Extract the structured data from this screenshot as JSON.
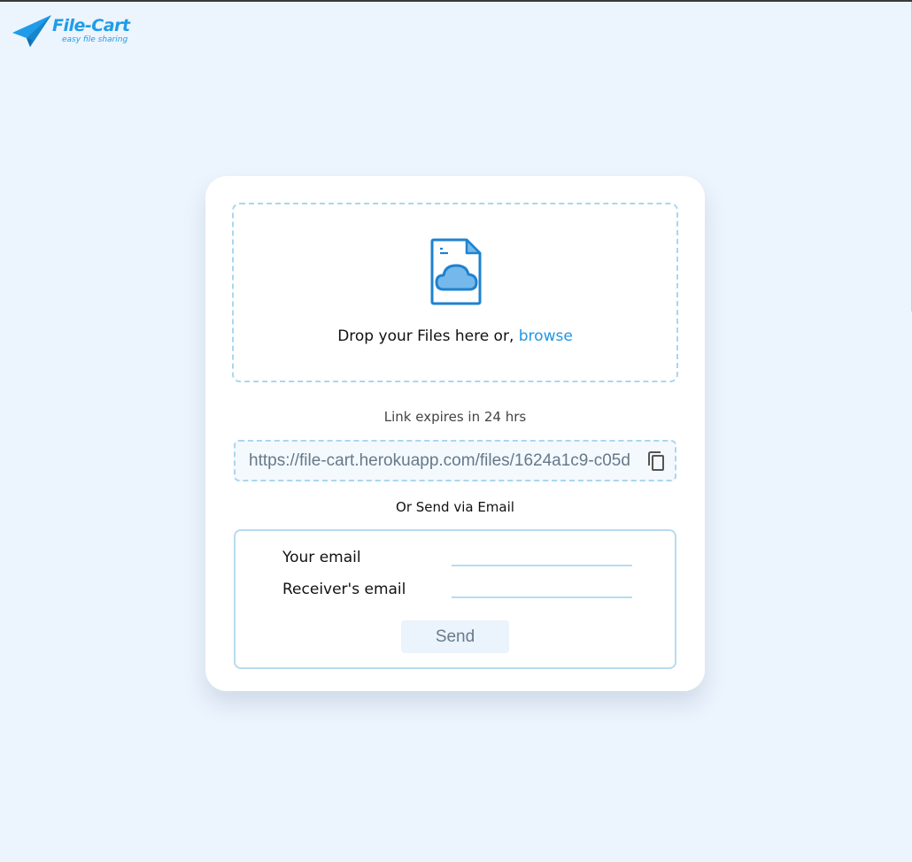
{
  "brand": {
    "name": "File-Cart",
    "tagline": "easy file sharing",
    "logo_icon": "paper-plane-icon",
    "color": "#1f9ce9"
  },
  "dropzone": {
    "icon": "file-cloud-icon",
    "prompt": "Drop your Files here or, ",
    "browse_label": "browse"
  },
  "share": {
    "expiry_text": "Link expires in 24 hrs",
    "link_value": "https://file-cart.herokuapp.com/files/1624a1c9-c05d",
    "copy_icon": "copy-icon"
  },
  "email": {
    "heading": "Or Send via Email",
    "sender_label": "Your email",
    "sender_value": "",
    "receiver_label": "Receiver's email",
    "receiver_value": "",
    "send_label": "Send"
  },
  "colors": {
    "background": "#ecf4fd",
    "accent": "#2196e3",
    "border": "#abd6ee"
  }
}
